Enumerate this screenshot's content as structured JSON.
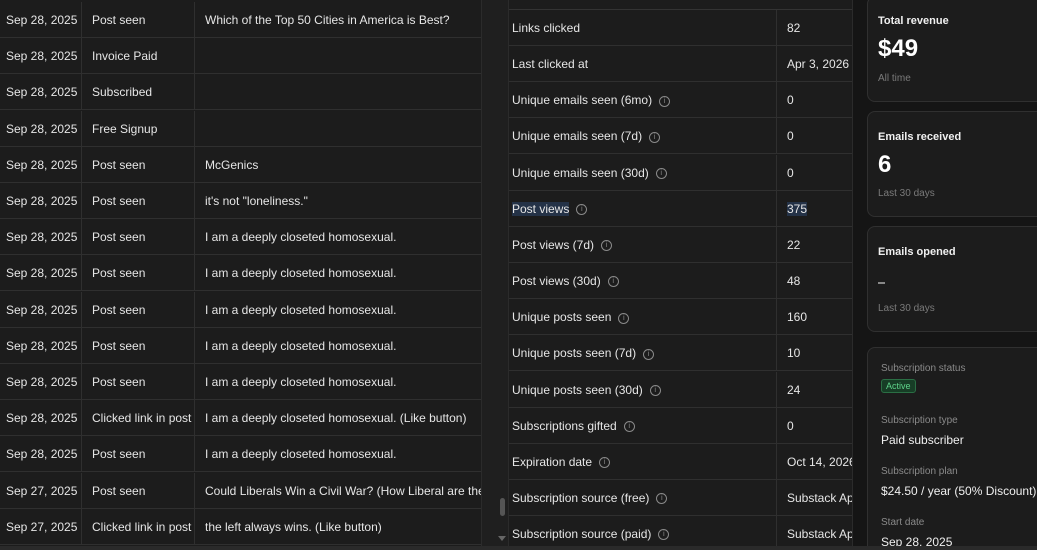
{
  "activity": [
    {
      "date": "Sep 28, 2025",
      "event": "Post seen",
      "detail": "Which of the Top 50 Cities in America is Best?"
    },
    {
      "date": "Sep 28, 2025",
      "event": "Invoice Paid",
      "detail": ""
    },
    {
      "date": "Sep 28, 2025",
      "event": "Subscribed",
      "detail": ""
    },
    {
      "date": "Sep 28, 2025",
      "event": "Free Signup",
      "detail": ""
    },
    {
      "date": "Sep 28, 2025",
      "event": "Post seen",
      "detail": "McGenics"
    },
    {
      "date": "Sep 28, 2025",
      "event": "Post seen",
      "detail": "it's not \"loneliness.\""
    },
    {
      "date": "Sep 28, 2025",
      "event": "Post seen",
      "detail": "I am a deeply closeted homosexual."
    },
    {
      "date": "Sep 28, 2025",
      "event": "Post seen",
      "detail": "I am a deeply closeted homosexual."
    },
    {
      "date": "Sep 28, 2025",
      "event": "Post seen",
      "detail": "I am a deeply closeted homosexual."
    },
    {
      "date": "Sep 28, 2025",
      "event": "Post seen",
      "detail": "I am a deeply closeted homosexual."
    },
    {
      "date": "Sep 28, 2025",
      "event": "Post seen",
      "detail": "I am a deeply closeted homosexual."
    },
    {
      "date": "Sep 28, 2025",
      "event": "Clicked link in post",
      "detail": "I am a deeply closeted homosexual. (Like button)"
    },
    {
      "date": "Sep 28, 2025",
      "event": "Post seen",
      "detail": "I am a deeply closeted homosexual."
    },
    {
      "date": "Sep 27, 2025",
      "event": "Post seen",
      "detail": "Could Liberals Win a Civil War? (How Liberal are the Gen"
    },
    {
      "date": "Sep 27, 2025",
      "event": "Clicked link in post",
      "detail": "the left always wins. (Like button)"
    }
  ],
  "stats": [
    {
      "label": "Links clicked",
      "value": "82",
      "info": false
    },
    {
      "label": "Last clicked at",
      "value": "Apr 3, 2026",
      "info": false
    },
    {
      "label": "Unique emails seen (6mo)",
      "value": "0",
      "info": true
    },
    {
      "label": "Unique emails seen (7d)",
      "value": "0",
      "info": true
    },
    {
      "label": "Unique emails seen (30d)",
      "value": "0",
      "info": true
    },
    {
      "label": "Post views",
      "value": "375",
      "info": true,
      "highlight": true
    },
    {
      "label": "Post views (7d)",
      "value": "22",
      "info": true
    },
    {
      "label": "Post views (30d)",
      "value": "48",
      "info": true
    },
    {
      "label": "Unique posts seen",
      "value": "160",
      "info": true
    },
    {
      "label": "Unique posts seen (7d)",
      "value": "10",
      "info": true
    },
    {
      "label": "Unique posts seen (30d)",
      "value": "24",
      "info": true
    },
    {
      "label": "Subscriptions gifted",
      "value": "0",
      "info": true
    },
    {
      "label": "Expiration date",
      "value": "Oct 14, 2026",
      "info": true
    },
    {
      "label": "Subscription source (free)",
      "value": "Substack App",
      "info": true
    },
    {
      "label": "Subscription source (paid)",
      "value": "Substack App",
      "info": true
    }
  ],
  "cards": {
    "revenue": {
      "title": "Total revenue",
      "value": "$49",
      "sub": "All time"
    },
    "received": {
      "title": "Emails received",
      "value": "6",
      "sub": "Last 30 days"
    },
    "opened": {
      "title": "Emails opened",
      "value": "-",
      "sub": "Last 30 days"
    }
  },
  "subscription": {
    "status_label": "Subscription status",
    "status": "Active",
    "type_label": "Subscription type",
    "type": "Paid subscriber",
    "plan_label": "Subscription plan",
    "plan": "$24.50 / year (50% Discount)",
    "start_label": "Start date",
    "start": "Sep 28, 2025"
  },
  "colors": {
    "background": "#1a1a1a",
    "active_badge": "#5fd38a",
    "highlight": "#243247"
  },
  "icons": {
    "info": "info-circle-icon"
  }
}
